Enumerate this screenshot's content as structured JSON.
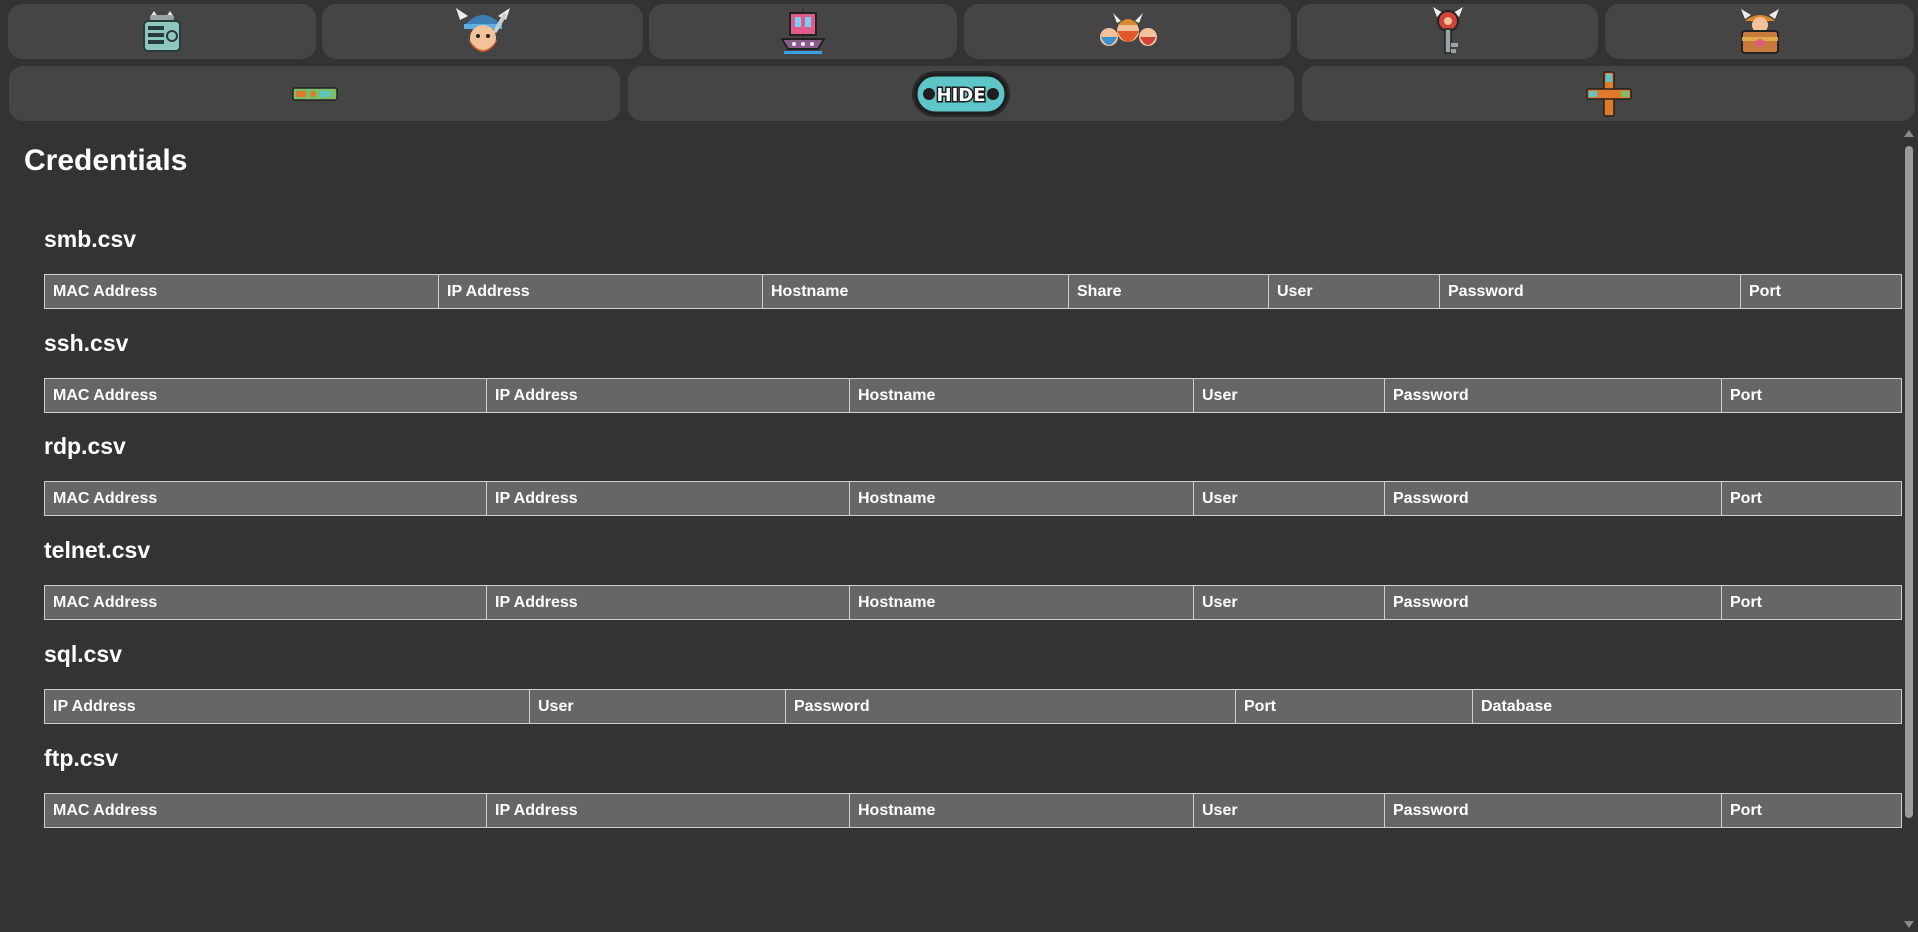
{
  "toolbar": {
    "row1": [
      {
        "name": "network-scanner-icon"
      },
      {
        "name": "viking-tools-icon"
      },
      {
        "name": "viking-ship-icon"
      },
      {
        "name": "viking-crew-icon"
      },
      {
        "name": "viking-key-icon"
      },
      {
        "name": "treasure-chest-icon"
      }
    ],
    "row2": [
      {
        "name": "terminal-status-icon"
      },
      {
        "name": "hide-toggle",
        "label": "HIDE"
      },
      {
        "name": "dpad-icon"
      }
    ]
  },
  "page_title": "Credentials",
  "sections": [
    {
      "title": "smb.csv",
      "columns": [
        "MAC Address",
        "IP Address",
        "Hostname",
        "Share",
        "User",
        "Password",
        "Port"
      ]
    },
    {
      "title": "ssh.csv",
      "columns": [
        "MAC Address",
        "IP Address",
        "Hostname",
        "User",
        "Password",
        "Port"
      ]
    },
    {
      "title": "rdp.csv",
      "columns": [
        "MAC Address",
        "IP Address",
        "Hostname",
        "User",
        "Password",
        "Port"
      ]
    },
    {
      "title": "telnet.csv",
      "columns": [
        "MAC Address",
        "IP Address",
        "Hostname",
        "User",
        "Password",
        "Port"
      ]
    },
    {
      "title": "sql.csv",
      "columns": [
        "IP Address",
        "User",
        "Password",
        "Port",
        "Database"
      ]
    },
    {
      "title": "ftp.csv",
      "columns": [
        "MAC Address",
        "IP Address",
        "Hostname",
        "User",
        "Password",
        "Port"
      ]
    }
  ],
  "colors": {
    "background": "#333333",
    "button": "#454545",
    "table_header": "#666666",
    "hide_accent": "#5ec6c9"
  }
}
